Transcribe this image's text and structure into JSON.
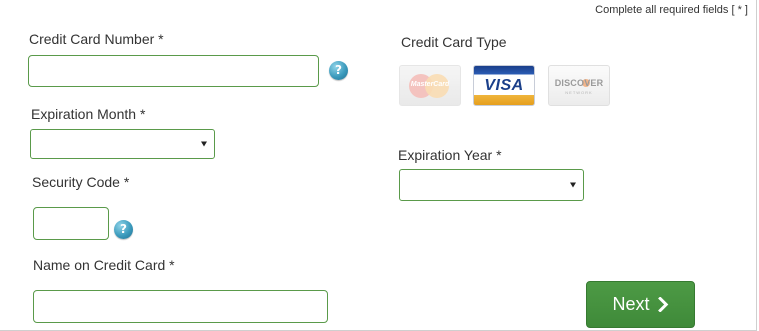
{
  "notice": "Complete all required fields [ * ]",
  "card_number": {
    "label": "Credit Card Number *",
    "value": ""
  },
  "card_type": {
    "label": "Credit Card Type",
    "cards": [
      {
        "name": "MasterCard",
        "text": "MasterCard",
        "selected": false
      },
      {
        "name": "Visa",
        "text": "VISA",
        "selected": true
      },
      {
        "name": "Discover",
        "text": "DISCOVER",
        "subtext": "NETWORK",
        "selected": false
      }
    ]
  },
  "expiration_month": {
    "label": "Expiration Month *",
    "selected": ""
  },
  "expiration_year": {
    "label": "Expiration Year *",
    "selected": ""
  },
  "security_code": {
    "label": "Security Code *",
    "value": ""
  },
  "name_on_card": {
    "label": "Name on Credit Card *",
    "value": ""
  },
  "help_icon_text": "?",
  "next_button": {
    "label": "Next"
  },
  "colors": {
    "field_border": "#5a9a4a",
    "button_green": "#4a9742",
    "help_blue": "#3c9bbd"
  }
}
